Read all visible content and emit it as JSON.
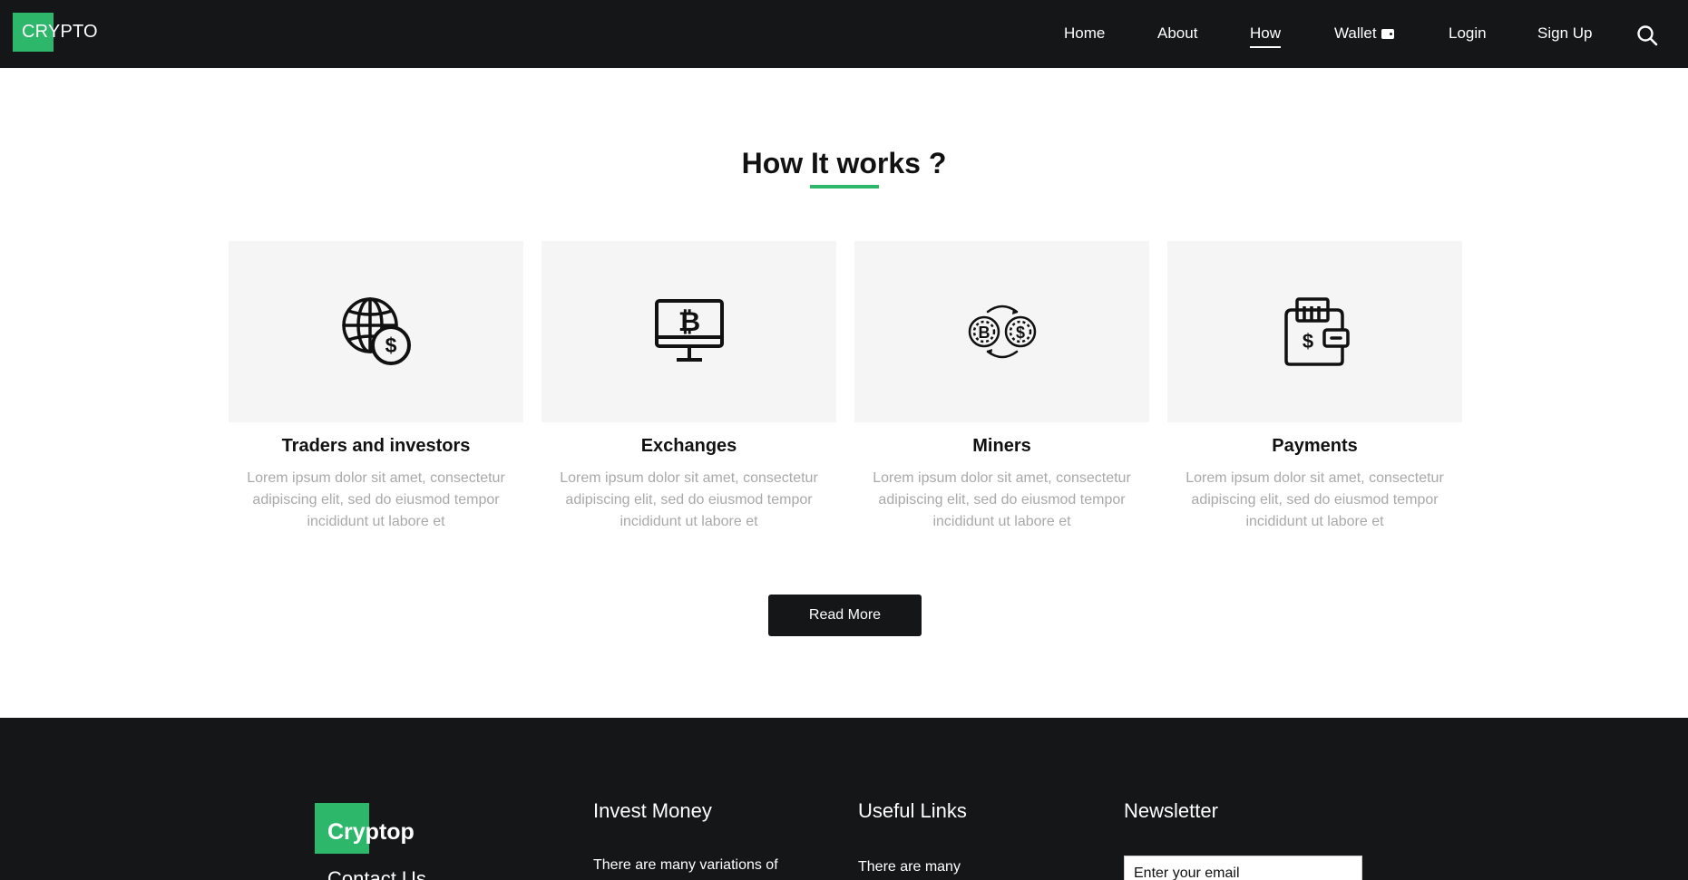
{
  "header": {
    "logo": "CRYPTO",
    "nav": [
      {
        "label": "Home"
      },
      {
        "label": "About"
      },
      {
        "label": "How",
        "active": true
      },
      {
        "label": "Wallet"
      },
      {
        "label": "Login"
      },
      {
        "label": "Sign Up"
      }
    ],
    "search_icon": "search-icon"
  },
  "how": {
    "title": "How It works ?",
    "cards": [
      {
        "icon": "globe-dollar-icon",
        "title": "Traders and investors",
        "text": "Lorem ipsum dolor sit amet, consectetur adipiscing elit, sed do eiusmod tempor incididunt ut labore et"
      },
      {
        "icon": "bitcoin-monitor-icon",
        "title": "Exchanges",
        "text": "Lorem ipsum dolor sit amet, consectetur adipiscing elit, sed do eiusmod tempor incididunt ut labore et"
      },
      {
        "icon": "bitcoin-dollar-exchange-icon",
        "title": "Miners",
        "text": "Lorem ipsum dolor sit amet, consectetur adipiscing elit, sed do eiusmod tempor incididunt ut labore et"
      },
      {
        "icon": "wallet-icon",
        "title": "Payments",
        "text": "Lorem ipsum dolor sit amet, consectetur adipiscing elit, sed do eiusmod tempor incididunt ut labore et"
      }
    ],
    "read_more": "Read More"
  },
  "footer": {
    "logo": "Cryptop",
    "contact": "Contact Us",
    "invest_heading": "Invest Money",
    "invest_text": "There are many variations of",
    "links_heading": "Useful Links",
    "links_text": "There are many",
    "newsletter_heading": "Newsletter",
    "newsletter_placeholder": "Enter your email"
  },
  "colors": {
    "accent": "#2db76a",
    "dark": "#151618",
    "card_bg": "#f5f5f6",
    "muted_text": "#a9a9a9"
  }
}
